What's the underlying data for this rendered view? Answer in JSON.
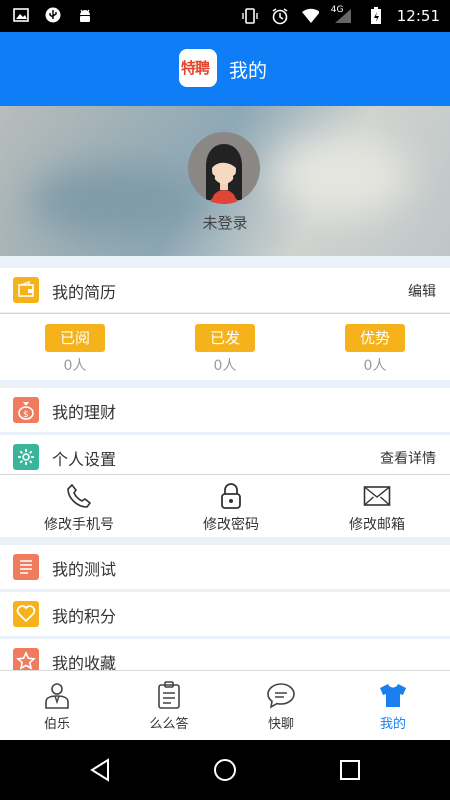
{
  "status_bar": {
    "time": "12:51",
    "network": "4G"
  },
  "header": {
    "title": "我的",
    "logo_text": "特聘"
  },
  "profile": {
    "login_text": "未登录"
  },
  "resume": {
    "label": "我的简历",
    "action": "编辑",
    "stats": [
      {
        "label": "已阅",
        "count": "0人"
      },
      {
        "label": "已发",
        "count": "0人"
      },
      {
        "label": "优势",
        "count": "0人"
      }
    ]
  },
  "finance": {
    "label": "我的理财"
  },
  "settings": {
    "label": "个人设置",
    "action": "查看详情",
    "items": [
      {
        "label": "修改手机号",
        "icon": "phone-icon"
      },
      {
        "label": "修改密码",
        "icon": "lock-icon"
      },
      {
        "label": "修改邮箱",
        "icon": "mail-icon"
      }
    ]
  },
  "test": {
    "label": "我的测试"
  },
  "points": {
    "label": "我的积分"
  },
  "favorites": {
    "label": "我的收藏"
  },
  "tabs": [
    {
      "label": "伯乐",
      "icon": "person-icon"
    },
    {
      "label": "么么答",
      "icon": "clipboard-icon"
    },
    {
      "label": "快聊",
      "icon": "chat-icon"
    },
    {
      "label": "我的",
      "icon": "shirt-icon",
      "active": true
    }
  ],
  "colors": {
    "primary": "#0f7df5",
    "badge": "#f5b21b",
    "finance": "#ef7c5c",
    "settings": "#3ab59a",
    "active_tab": "#1a7ff0"
  }
}
